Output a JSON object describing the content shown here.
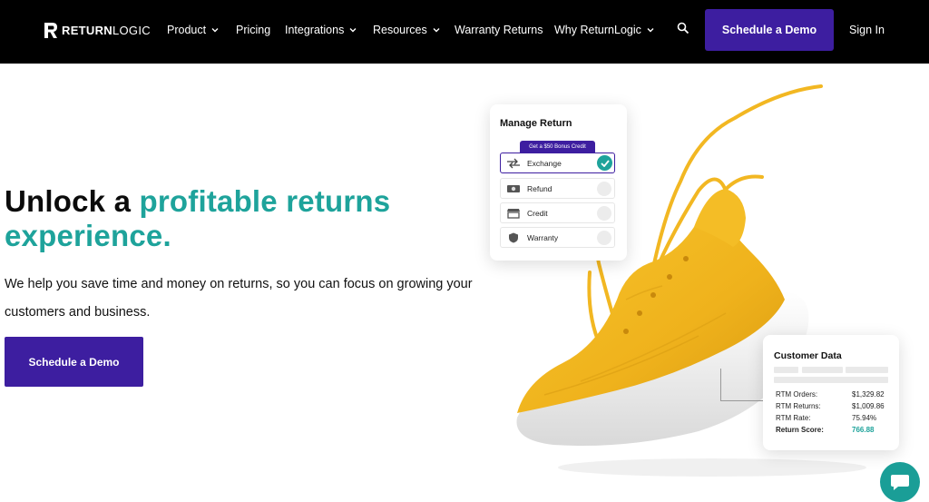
{
  "nav": {
    "logo_bold": "RETURN",
    "logo_light": "LOGIC",
    "items": [
      {
        "label": "Product",
        "has_dropdown": true
      },
      {
        "label": "Pricing",
        "has_dropdown": false
      },
      {
        "label": "Integrations",
        "has_dropdown": true
      },
      {
        "label": "Resources",
        "has_dropdown": true
      },
      {
        "label": "Warranty Returns",
        "has_dropdown": false
      },
      {
        "label": "Why ReturnLogic",
        "has_dropdown": true
      }
    ],
    "search_icon": "search-icon",
    "demo_label": "Schedule a Demo",
    "signin_label": "Sign In"
  },
  "hero": {
    "title_part1": "Unlock a ",
    "title_part2": "profitable returns",
    "title_part3": "experience.",
    "subtitle": "We help you save time and money on returns, so you can focus on growing your customers and business.",
    "cta_label": "Schedule a Demo"
  },
  "manage_return": {
    "title": "Manage Return",
    "bonus_label": "Get a $50 Bonus Credit",
    "options": [
      {
        "label": "Exchange",
        "icon": "exchange-icon",
        "selected": true
      },
      {
        "label": "Refund",
        "icon": "cash-icon",
        "selected": false
      },
      {
        "label": "Credit",
        "icon": "store-icon",
        "selected": false
      },
      {
        "label": "Warranty",
        "icon": "shield-icon",
        "selected": false
      }
    ]
  },
  "customer_data": {
    "title": "Customer Data",
    "rows": [
      {
        "label": "RTM Orders:",
        "value": "$1,329.82"
      },
      {
        "label": "RTM Returns:",
        "value": "$1,009.86"
      },
      {
        "label": "RTM Rate:",
        "value": "75.94%"
      },
      {
        "label": "Return Score:",
        "value": "766.88"
      }
    ]
  },
  "colors": {
    "brand_purple": "#3d1ea0",
    "teal": "#1ea39b",
    "shoe_yellow": "#f2b722",
    "nav_bg": "#000000"
  },
  "chat_icon": "chat-bubble-icon"
}
